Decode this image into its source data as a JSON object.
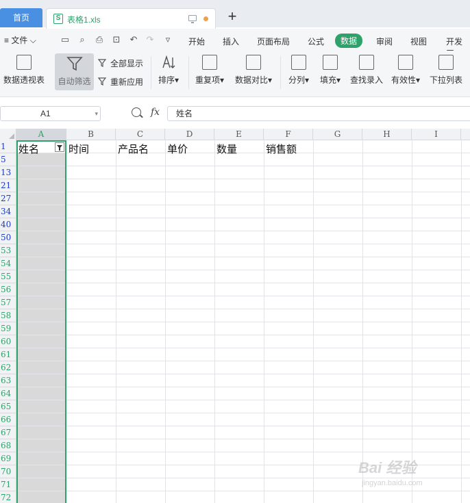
{
  "tabs": {
    "home_label": "首页",
    "file_label": "表格1.xls",
    "file_icon_letter": "S",
    "new_tab_symbol": "+"
  },
  "menu": {
    "file_label": "文件",
    "tabs": [
      "开始",
      "插入",
      "页面布局",
      "公式",
      "数据",
      "审阅",
      "视图",
      "开发工"
    ],
    "active_tab": "数据"
  },
  "ribbon": {
    "pivot": "数据透视表",
    "autofilter": "自动筛选",
    "show_all": "全部显示",
    "reapply": "重新应用",
    "sort": "排序",
    "duplicates": "重复项",
    "compare": "数据对比",
    "split": "分列",
    "fill": "填充",
    "lookup": "查找录入",
    "validity": "有效性",
    "dropdown": "下拉列表",
    "dropdown_caret": "▾"
  },
  "formula_bar": {
    "cell_ref": "A1",
    "fx_label": "fx",
    "value": "姓名"
  },
  "sheet": {
    "columns": [
      "A",
      "B",
      "C",
      "D",
      "E",
      "F",
      "G",
      "H",
      "I"
    ],
    "rows": [
      "1",
      "5",
      "13",
      "21",
      "27",
      "34",
      "40",
      "50",
      "53",
      "54",
      "55",
      "56",
      "57",
      "58",
      "59",
      "60",
      "61",
      "62",
      "63",
      "64",
      "65",
      "66",
      "67",
      "68",
      "69",
      "70",
      "71",
      "72"
    ],
    "header_cells": [
      "姓名",
      "时间",
      "产品名",
      "单价",
      "数量",
      "销售额"
    ]
  },
  "watermark": {
    "brand": "Bai 经验",
    "url": "jingyan.baidu.com"
  },
  "colors": {
    "accent_green": "#2ea26a",
    "home_tab_blue": "#4a90e2",
    "row_header_blue": "#1b3ac5"
  }
}
